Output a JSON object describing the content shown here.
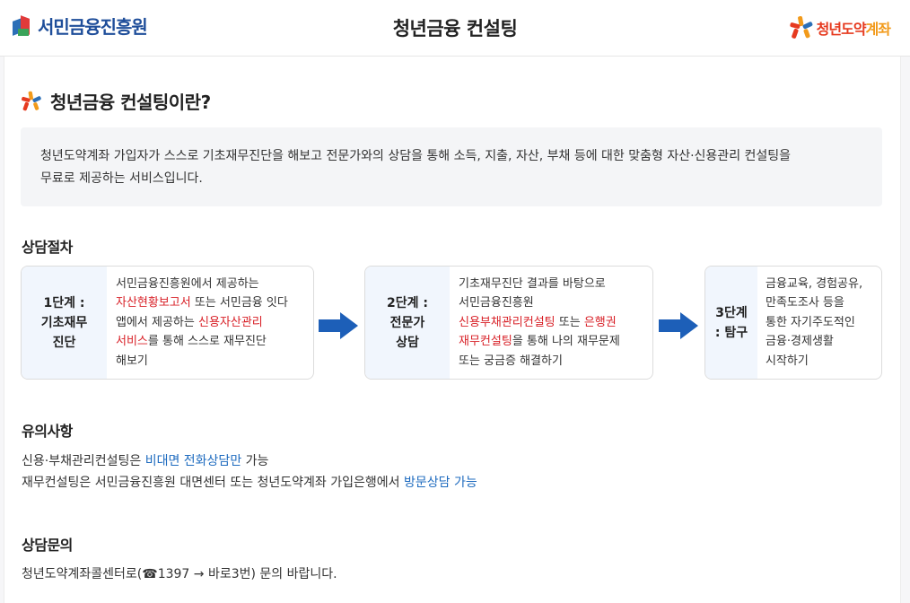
{
  "header": {
    "left_logo_text": "서민금융진흥원",
    "title": "청년금융 컨설팅",
    "right_logo_text_1": "청년도약",
    "right_logo_text_2": "계좌"
  },
  "colors": {
    "red": "#d81f26",
    "blue": "#1e6bbf",
    "step_head_bg": "#f1f6fd",
    "arrow": "#1d5fb8"
  },
  "intro": {
    "title": "청년금융 컨설팅이란?",
    "line1": "청년도약계좌 가입자가 스스로 기초재무진단을 해보고 전문가와의 상담을 통해 소득, 지출, 자산, 부채 등에 대한 맞춤형 자산·신용관리 컨설팅을",
    "line2": "무료로 제공하는 서비스입니다."
  },
  "procedure": {
    "title": "상담절차",
    "steps": [
      {
        "head_1": "1단계 :",
        "head_2": "기초재무",
        "head_3": "진단",
        "body_1": "서민금융진흥원에서 제공하는",
        "body_red_1": "자산현황보고서",
        "body_2": " 또는 서민금융 잇다",
        "body_3": "앱에서 제공하는 ",
        "body_red_2": "신용자산관리",
        "body_red_3": "서비스",
        "body_4": "를 통해 스스로 재무진단",
        "body_5": "해보기"
      },
      {
        "head_1": "2단계 :",
        "head_2": "전문가",
        "head_3": "상담",
        "body_1": "기초재무진단 결과를 바탕으로",
        "body_2": "서민금융진흥원",
        "body_red_1": "신용부채관리컨설팅",
        "body_3": " 또는 ",
        "body_red_2": "은행권",
        "body_red_3": "재무컨설팅",
        "body_4": "을 통해 나의 재무문제",
        "body_5": "또는 궁금증 해결하기"
      },
      {
        "head_1": "3단계",
        "head_2": ": 탐구",
        "body_1": "금융교육, 경험공유,",
        "body_2": "만족도조사 등을",
        "body_3": "통한 자기주도적인",
        "body_4": "금융·경제생활",
        "body_5": "시작하기"
      }
    ]
  },
  "notes": {
    "title": "유의사항",
    "line1_a": "신용·부채관리컨설팅은 ",
    "line1_b": "비대면 전화상담만",
    "line1_c": " 가능",
    "line2_a": "재무컨설팅은 서민금융진흥원 대면센터 또는 청년도약계좌 가입은행에서 ",
    "line2_b": "방문상담 가능"
  },
  "contact": {
    "title": "상담문의",
    "text": "청년도약계좌콜센터로(☎1397 → 바로3번) 문의 바랍니다."
  }
}
